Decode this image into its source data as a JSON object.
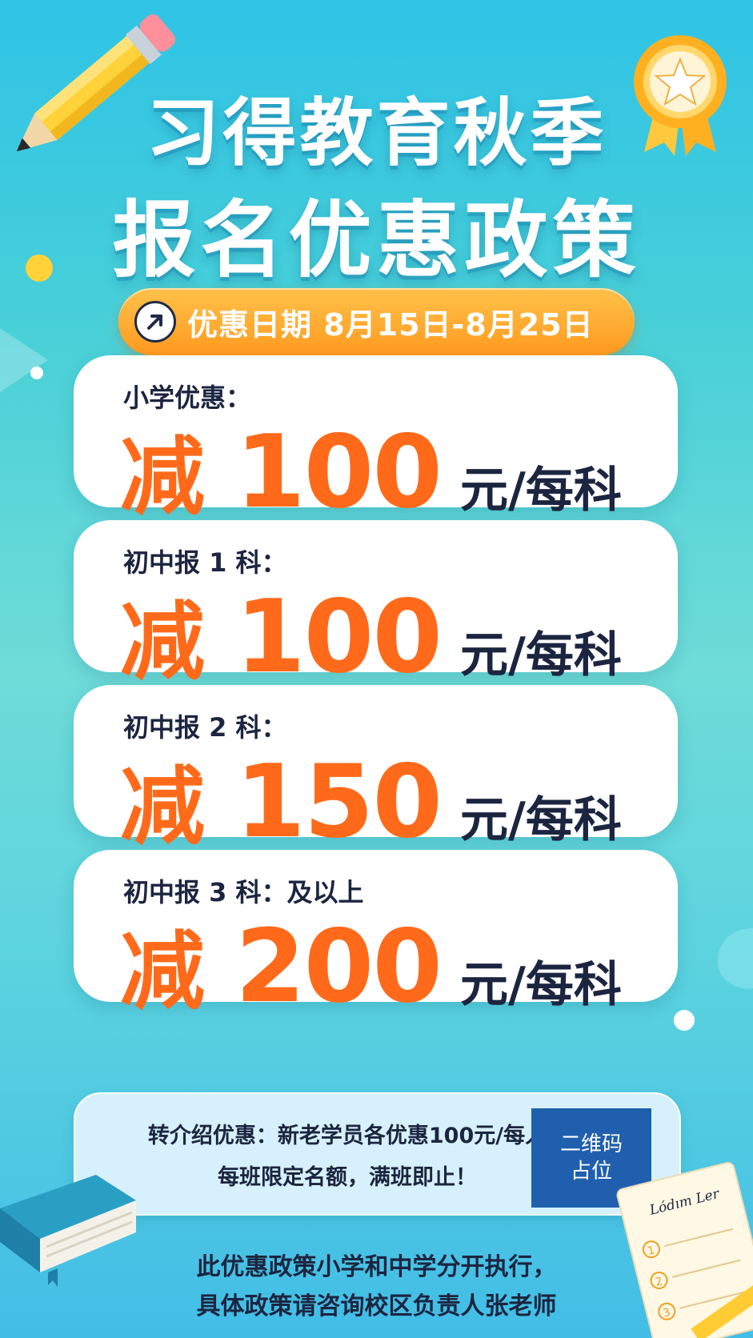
{
  "poster": {
    "title_line1": "习得教育秋季",
    "title_line2": "报名优惠政策",
    "date_text": "优惠日期 8月15日-8月25日",
    "date_icon": "arrow-up-right-icon",
    "discounts": [
      {
        "label": "小学优惠：",
        "reduce": "减",
        "amount": "100",
        "unit": "元/每科"
      },
      {
        "label": "初中报 1 科：",
        "reduce": "减",
        "amount": "100",
        "unit": "元/每科"
      },
      {
        "label": "初中报 2 科：",
        "reduce": "减",
        "amount": "150",
        "unit": "元/每科"
      },
      {
        "label": "初中报 3 科：及以上",
        "reduce": "减",
        "amount": "200",
        "unit": "元/每科"
      }
    ],
    "referral_line1": "转介绍优惠：新老学员各优惠100元/每人",
    "referral_line2": "每班限定名额，满班即止！",
    "qr_line1": "二维码",
    "qr_line2": "占位",
    "footer_line1": "此优惠政策小学和中学分开执行，",
    "footer_line2": "具体政策请咨询校区负责人张老师",
    "notepad_heading": "Lódım Ler",
    "notepad_items": [
      "1",
      "2",
      "3"
    ]
  },
  "colors": {
    "accent_orange": "#ff6a1a",
    "pill_orange": "#ff9a1f",
    "text_dark": "#1c2540",
    "qr_blue": "#1f5fae",
    "background_teal": "#49d0d8"
  }
}
